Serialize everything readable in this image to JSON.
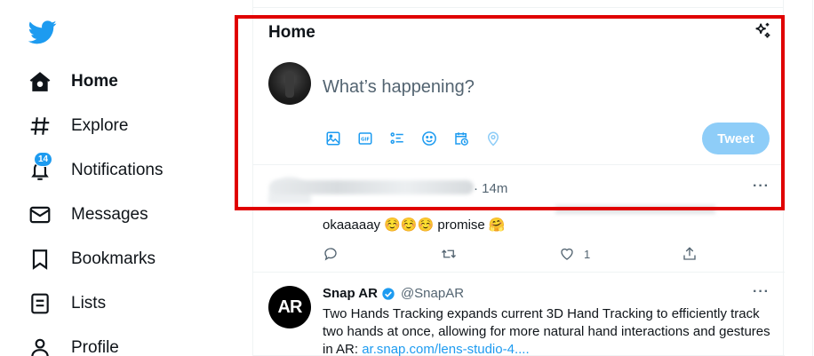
{
  "sidebar": {
    "logo": "twitter-bird-icon",
    "items": [
      {
        "label": "Home",
        "icon": "home-icon",
        "active": true
      },
      {
        "label": "Explore",
        "icon": "hashtag-icon"
      },
      {
        "label": "Notifications",
        "icon": "bell-icon",
        "badge": "14"
      },
      {
        "label": "Messages",
        "icon": "envelope-icon"
      },
      {
        "label": "Bookmarks",
        "icon": "bookmark-icon"
      },
      {
        "label": "Lists",
        "icon": "list-icon"
      },
      {
        "label": "Profile",
        "icon": "person-icon"
      }
    ]
  },
  "header": {
    "title": "Home",
    "sparkle_icon": "sparkle-icon"
  },
  "composer": {
    "placeholder": "What’s happening?",
    "tools": [
      "image-icon",
      "gif-icon",
      "poll-icon",
      "emoji-icon",
      "schedule-icon",
      "location-icon"
    ],
    "tweet_button": "Tweet"
  },
  "tweet1": {
    "time": "· 14m",
    "text": "okaaaaay ☺️☺️☺️ promise 🤗",
    "more": "···",
    "likes": "1"
  },
  "tweet2": {
    "name": "Snap AR",
    "handle": "@SnapAR",
    "avatar_text": "AR",
    "more": "···",
    "text": "Two Hands Tracking expands current 3D Hand Tracking to efficiently track two hands at once, allowing for more natural hand interactions and gestures in AR: ",
    "link": "ar.snap.com/lens-studio-4...."
  },
  "colors": {
    "accent": "#1d9bf0",
    "tweet_button": "#8ecdf8",
    "highlight": "#e00000"
  }
}
